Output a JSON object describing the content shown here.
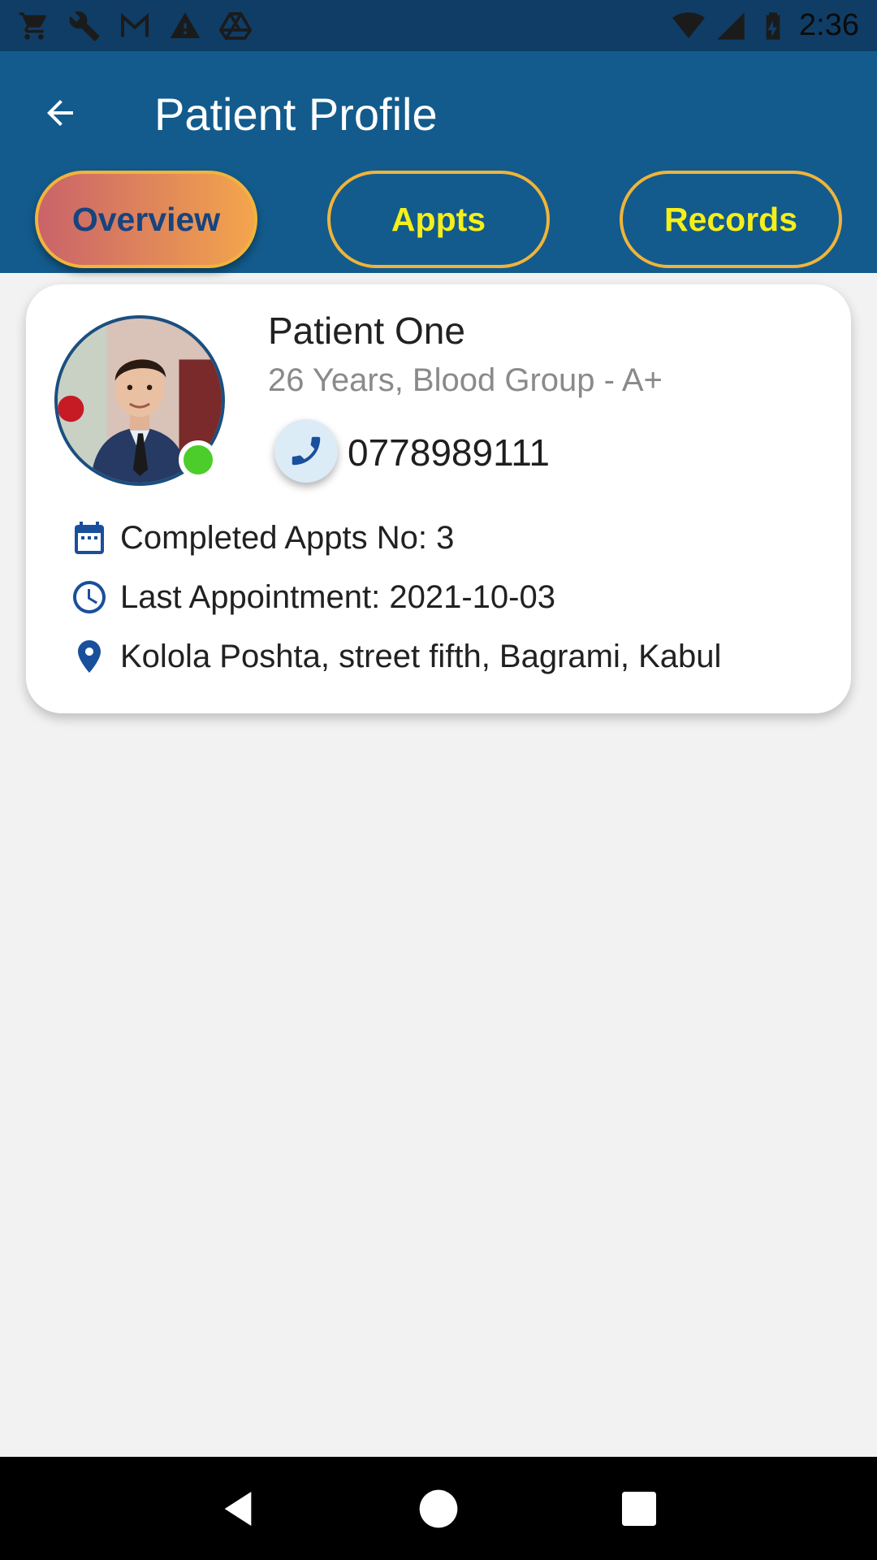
{
  "status_bar": {
    "time": "2:36",
    "left_icons": [
      "cart-icon",
      "wrench-icon",
      "gmail-icon",
      "warning-icon",
      "drive-icon"
    ],
    "right_icons": [
      "wifi-icon",
      "signal-icon",
      "battery-charging-icon"
    ]
  },
  "app_bar": {
    "title": "Patient Profile",
    "back_icon": "arrow-left-icon"
  },
  "tabs": [
    {
      "label": "Overview",
      "active": true
    },
    {
      "label": "Appts",
      "active": false
    },
    {
      "label": "Records",
      "active": false
    }
  ],
  "patient": {
    "name": "Patient One",
    "subtitle": "26 Years, Blood Group - A+",
    "phone": "0778989111",
    "online": true,
    "completed_appts": "Completed Appts No: 3",
    "last_appointment": "Last Appointment: 2021-10-03",
    "address": "Kolola Poshta, street fifth, Bagrami, Kabul"
  },
  "colors": {
    "app_bar": "#135b8c",
    "status_bar": "#0f3d66",
    "tab_border": "#f0b43a",
    "tab_text": "#f5ef1a",
    "tab_active_gradient_start": "#c9636a",
    "tab_active_gradient_end": "#f4a54c",
    "accent_blue": "#1a4f9c",
    "online": "#4ccd2a"
  },
  "nav_bar": {
    "icons": [
      "back-triangle-icon",
      "home-circle-icon",
      "recents-square-icon"
    ]
  }
}
